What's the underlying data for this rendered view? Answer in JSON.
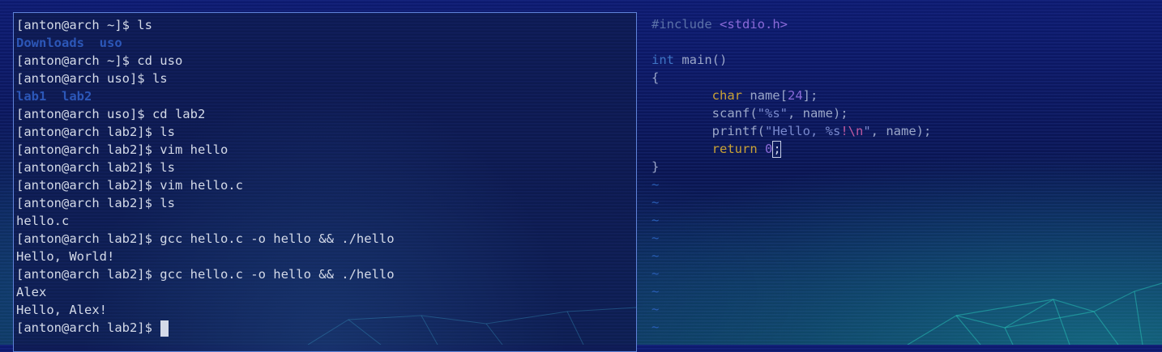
{
  "terminal": {
    "lines": [
      {
        "type": "prompt",
        "text": "[anton@arch ~]$ ls"
      },
      {
        "type": "dir",
        "text": "Downloads  uso"
      },
      {
        "type": "prompt",
        "text": "[anton@arch ~]$ cd uso"
      },
      {
        "type": "prompt",
        "text": "[anton@arch uso]$ ls"
      },
      {
        "type": "dir",
        "text": "lab1  lab2"
      },
      {
        "type": "prompt",
        "text": "[anton@arch uso]$ cd lab2"
      },
      {
        "type": "prompt",
        "text": "[anton@arch lab2]$ ls"
      },
      {
        "type": "prompt",
        "text": "[anton@arch lab2]$ vim hello"
      },
      {
        "type": "prompt",
        "text": "[anton@arch lab2]$ ls"
      },
      {
        "type": "prompt",
        "text": "[anton@arch lab2]$ vim hello.c"
      },
      {
        "type": "prompt",
        "text": "[anton@arch lab2]$ ls"
      },
      {
        "type": "output",
        "text": "hello.c"
      },
      {
        "type": "prompt",
        "text": "[anton@arch lab2]$ gcc hello.c -o hello && ./hello"
      },
      {
        "type": "output",
        "text": "Hello, World!"
      },
      {
        "type": "prompt",
        "text": "[anton@arch lab2]$ gcc hello.c -o hello && ./hello"
      },
      {
        "type": "output",
        "text": "Alex"
      },
      {
        "type": "output",
        "text": "Hello, Alex!"
      }
    ],
    "current_prompt": "[anton@arch lab2]$ "
  },
  "editor": {
    "code": {
      "include_directive": "#include",
      "include_header": "<stdio.h>",
      "main_type": "int",
      "main_sig": " main()",
      "open_brace": "{",
      "indent": "        ",
      "char_type": "char",
      "decl_name": " name[",
      "array_size": "24",
      "decl_end": "];",
      "scanf_open": "scanf(",
      "scanf_str": "\"%s\"",
      "scanf_args": ", name);",
      "printf_open": "printf(",
      "printf_str_a": "\"Hello, %s",
      "printf_bang": "!",
      "printf_esc": "\\n",
      "printf_quote": "\"",
      "printf_args": ", name);",
      "return_kw": "return",
      "return_val": "0",
      "return_end": ";",
      "close_brace": "}"
    },
    "tilde": "~",
    "tilde_count": 9
  },
  "colors": {
    "prompt_text": "#d4dae8",
    "dir_text": "#2c57b8",
    "terminal_border": "#5f82d8",
    "type_keyword": "#c9a235",
    "number_literal": "#8a6ad8",
    "escape_sequence": "#c05aa0",
    "tilde": "#2a5fb8"
  }
}
